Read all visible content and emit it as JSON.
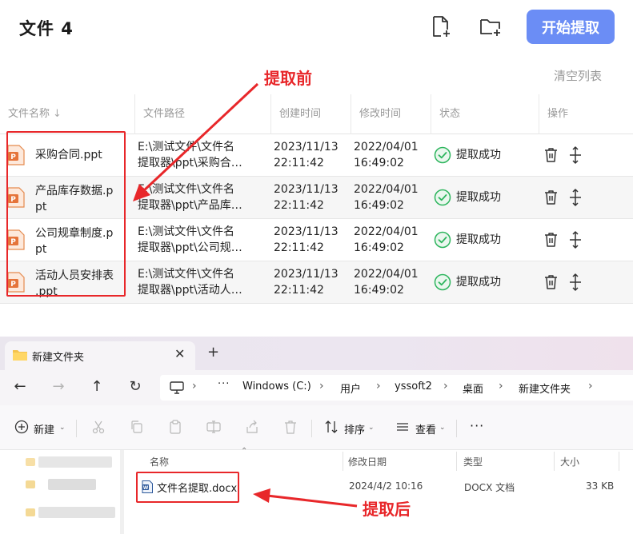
{
  "app": {
    "title": "文件 4",
    "start_button": "开始提取",
    "clear_list": "清空列表"
  },
  "table": {
    "headers": {
      "name": "文件名称",
      "path": "文件路径",
      "created": "创建时间",
      "modified": "修改时间",
      "status": "状态",
      "actions": "操作"
    },
    "rows": [
      {
        "name_1": "采购合同.ppt",
        "name_2": "",
        "path_1": "E:\\测试文件\\文件名",
        "path_2": "提取器\\ppt\\采购合…",
        "created_1": "2023/11/13",
        "created_2": "22:11:42",
        "modified_1": "2022/04/01",
        "modified_2": "16:49:02",
        "status": "提取成功"
      },
      {
        "name_1": "产品库存数据.p",
        "name_2": "pt",
        "path_1": "E:\\测试文件\\文件名",
        "path_2": "提取器\\ppt\\产品库…",
        "created_1": "2023/11/13",
        "created_2": "22:11:42",
        "modified_1": "2022/04/01",
        "modified_2": "16:49:02",
        "status": "提取成功"
      },
      {
        "name_1": "公司规章制度.p",
        "name_2": "pt",
        "path_1": "E:\\测试文件\\文件名",
        "path_2": "提取器\\ppt\\公司规…",
        "created_1": "2023/11/13",
        "created_2": "22:11:42",
        "modified_1": "2022/04/01",
        "modified_2": "16:49:02",
        "status": "提取成功"
      },
      {
        "name_1": "活动人员安排表",
        "name_2": ".ppt",
        "path_1": "E:\\测试文件\\文件名",
        "path_2": "提取器\\ppt\\活动人…",
        "created_1": "2023/11/13",
        "created_2": "22:11:42",
        "modified_1": "2022/04/01",
        "modified_2": "16:49:02",
        "status": "提取成功"
      }
    ]
  },
  "annotations": {
    "before": "提取前",
    "after": "提取后",
    "color": "#e8272a"
  },
  "explorer": {
    "tab_title": "新建文件夹",
    "tab_close": "✕",
    "new_tab": "+",
    "breadcrumb": [
      "Windows (C:)",
      "用户",
      "yssoft2",
      "桌面",
      "新建文件夹"
    ],
    "more": "···",
    "toolbar": {
      "new": "新建",
      "sort": "排序",
      "view": "查看",
      "more": "···"
    },
    "columns": {
      "name": "名称",
      "modified": "修改日期",
      "type": "类型",
      "size": "大小"
    },
    "files": [
      {
        "name": "文件名提取.docx",
        "modified": "2024/4/2 10:16",
        "type": "DOCX 文档",
        "size": "33 KB"
      }
    ]
  },
  "colors": {
    "accent": "#6b8df5",
    "success": "#2db55d",
    "word_blue": "#2b579a",
    "ppt_orange": "#d35230"
  }
}
